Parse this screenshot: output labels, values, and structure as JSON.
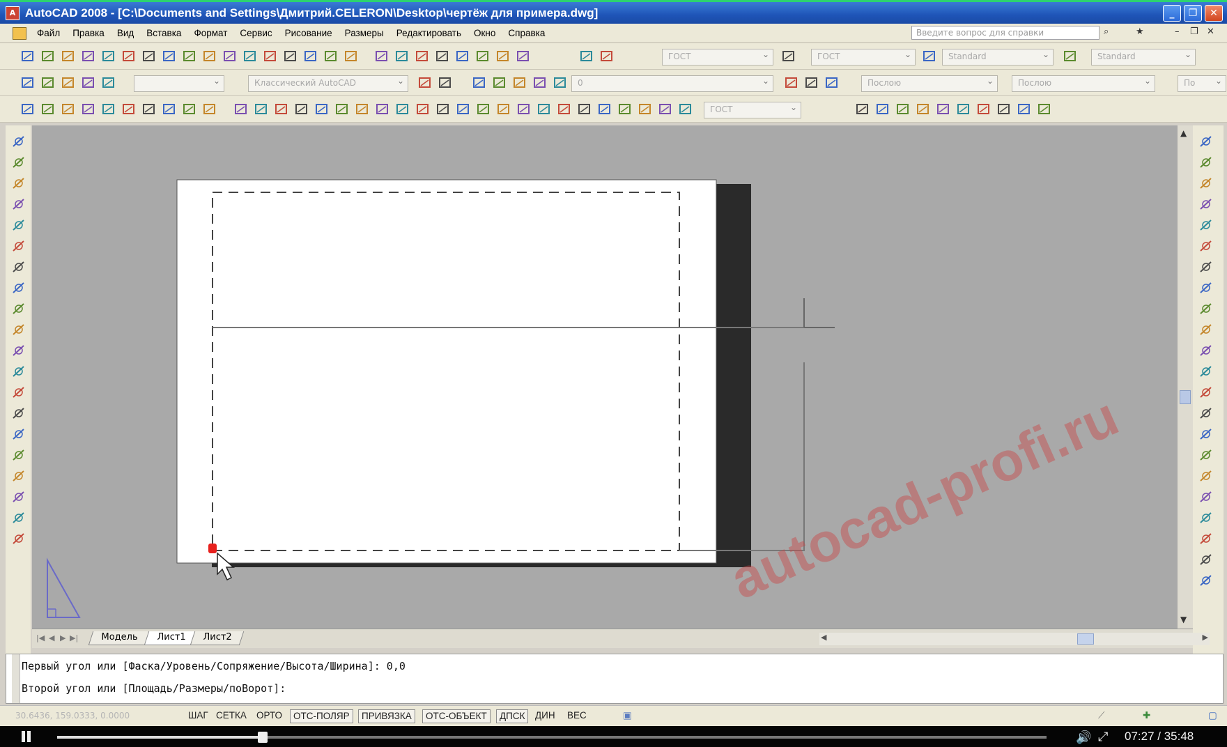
{
  "window": {
    "title": "AutoCAD 2008 - [C:\\Documents and Settings\\Дмитрий.CELERON\\Desktop\\чертёж для примера.dwg]"
  },
  "menu": {
    "items": [
      "Файл",
      "Правка",
      "Вид",
      "Вставка",
      "Формат",
      "Сервис",
      "Рисование",
      "Размеры",
      "Редактировать",
      "Окно",
      "Справка"
    ],
    "help_placeholder": "Введите вопрос для справки"
  },
  "toolbars": {
    "text_style": "ГОСТ",
    "dim_style": "ГОСТ",
    "table_style": "Standard",
    "multileader_style": "Standard",
    "workspace": "Классический AutoCAD",
    "layer": "0",
    "color": "Послою",
    "linetype": "Послою",
    "lineweight": "По",
    "dim_style2": "ГОСТ"
  },
  "layout_tabs": {
    "tabs": [
      "Модель",
      "Лист1",
      "Лист2"
    ],
    "active": "Лист1"
  },
  "command_line": {
    "line1": "Первый угол или [Фаска/Уровень/Сопряжение/Высота/Ширина]: 0,0",
    "line2": "Второй угол или [Площадь/Размеры/поВорот]:"
  },
  "status_bar": {
    "coordinates": "30.6436, 159.0333, 0.0000",
    "toggles": [
      {
        "label": "ШАГ",
        "on": false
      },
      {
        "label": "СЕТКА",
        "on": false
      },
      {
        "label": "ОРТО",
        "on": false
      },
      {
        "label": "ОТС-ПОЛЯР",
        "on": true
      },
      {
        "label": "ПРИВЯЗКА",
        "on": true
      },
      {
        "label": "ОТС-ОБЪЕКТ",
        "on": true
      },
      {
        "label": "ДПСК",
        "on": true
      },
      {
        "label": "ДИН",
        "on": false
      },
      {
        "label": "ВЕС",
        "on": false
      }
    ]
  },
  "player": {
    "time": "07:27 / 35:48",
    "progress": 0.208
  },
  "watermark": "autocad-profi.ru",
  "colors": {
    "titlebar": "#1f55b8",
    "canvas_bg": "#a9a9a9",
    "paper": "#ffffff",
    "watermark": "#c84646"
  }
}
